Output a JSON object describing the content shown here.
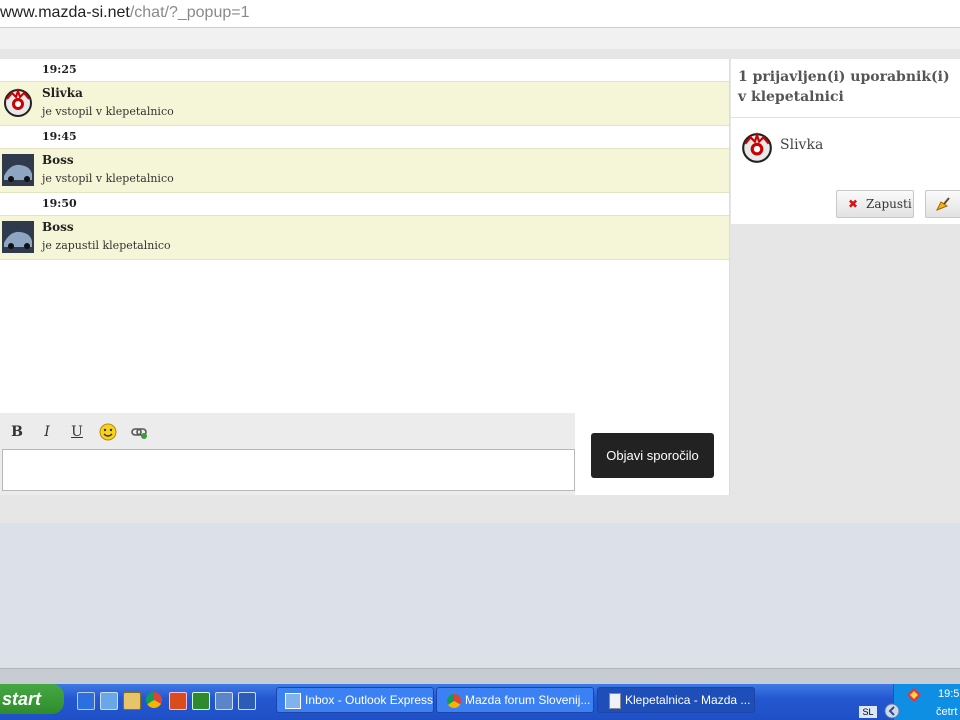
{
  "address_bar": {
    "domain": "www.mazda-si.net",
    "path": "/chat/?_popup=1"
  },
  "chat": {
    "entries": [
      {
        "time": "19:25",
        "user": "Slivka",
        "text": "je vstopil v klepetalnico",
        "avatar": "slivka"
      },
      {
        "time": "19:45",
        "user": "Boss",
        "text": "je vstopil v klepetalnico",
        "avatar": "boss"
      },
      {
        "time": "19:50",
        "user": "Boss",
        "text": "je zapustil klepetalnico",
        "avatar": "boss"
      }
    ],
    "toolbar": {
      "bold": "B",
      "italic": "I",
      "underline": "U"
    },
    "post_label": "Objavi sporočilo",
    "input_value": ""
  },
  "users_panel": {
    "heading": "1 prijavljen(i) uporabnik(i) v klepetalnici",
    "users": [
      {
        "name": "Slivka"
      }
    ],
    "leave_label": "Zapusti"
  },
  "taskbar": {
    "start_label": "start",
    "windows": [
      {
        "label": "Inbox - Outlook Express",
        "active": false
      },
      {
        "label": "Mazda forum Slovenij...",
        "active": false
      },
      {
        "label": "Klepetalnica - Mazda ...",
        "active": true
      }
    ],
    "language": "SL",
    "clock": "19:5",
    "day": "četrt"
  },
  "colors": {
    "message_bg": "#f5f5d7",
    "post_button": "#222222",
    "taskbar": "#2458d0",
    "start": "#3a9b38"
  }
}
